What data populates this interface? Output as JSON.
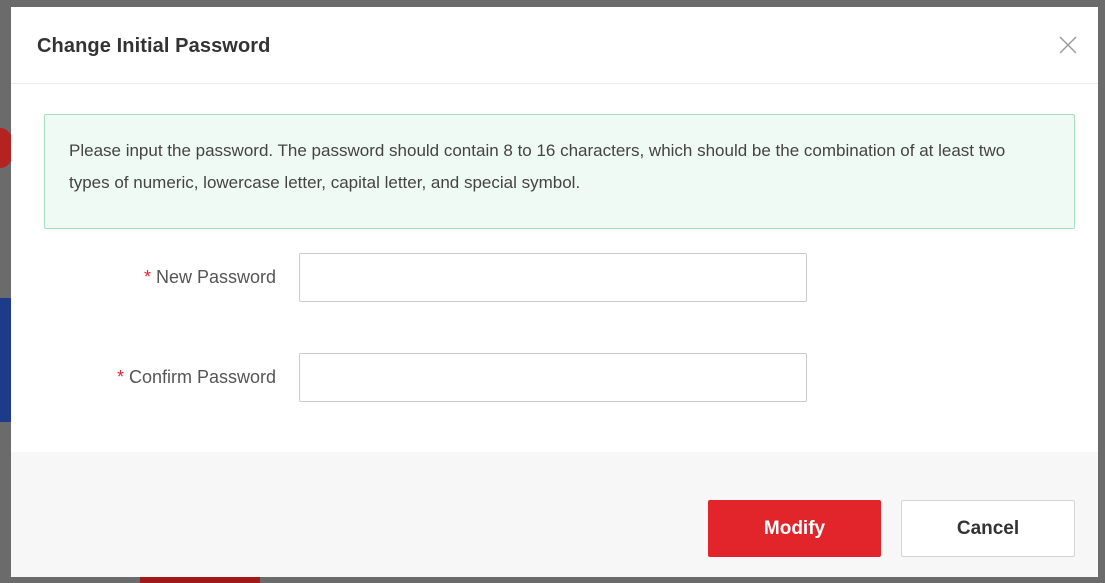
{
  "dialog": {
    "title": "Change Initial Password",
    "notice": "Please input the password. The password should contain 8 to 16 characters, which should be the combination of at least two types of numeric, lowercase letter, capital letter, and special symbol."
  },
  "form": {
    "required_marker": "*",
    "new_password": {
      "label": "New Password",
      "value": "",
      "placeholder": ""
    },
    "confirm_password": {
      "label": "Confirm Password",
      "value": "",
      "placeholder": ""
    }
  },
  "buttons": {
    "modify_label": "Modify",
    "cancel_label": "Cancel"
  },
  "colors": {
    "accent": "#e2242b",
    "notice_bg": "#effaf4",
    "notice_border": "#a8dcc0",
    "required": "#e0262e"
  },
  "icons": {
    "close": "close-icon"
  }
}
